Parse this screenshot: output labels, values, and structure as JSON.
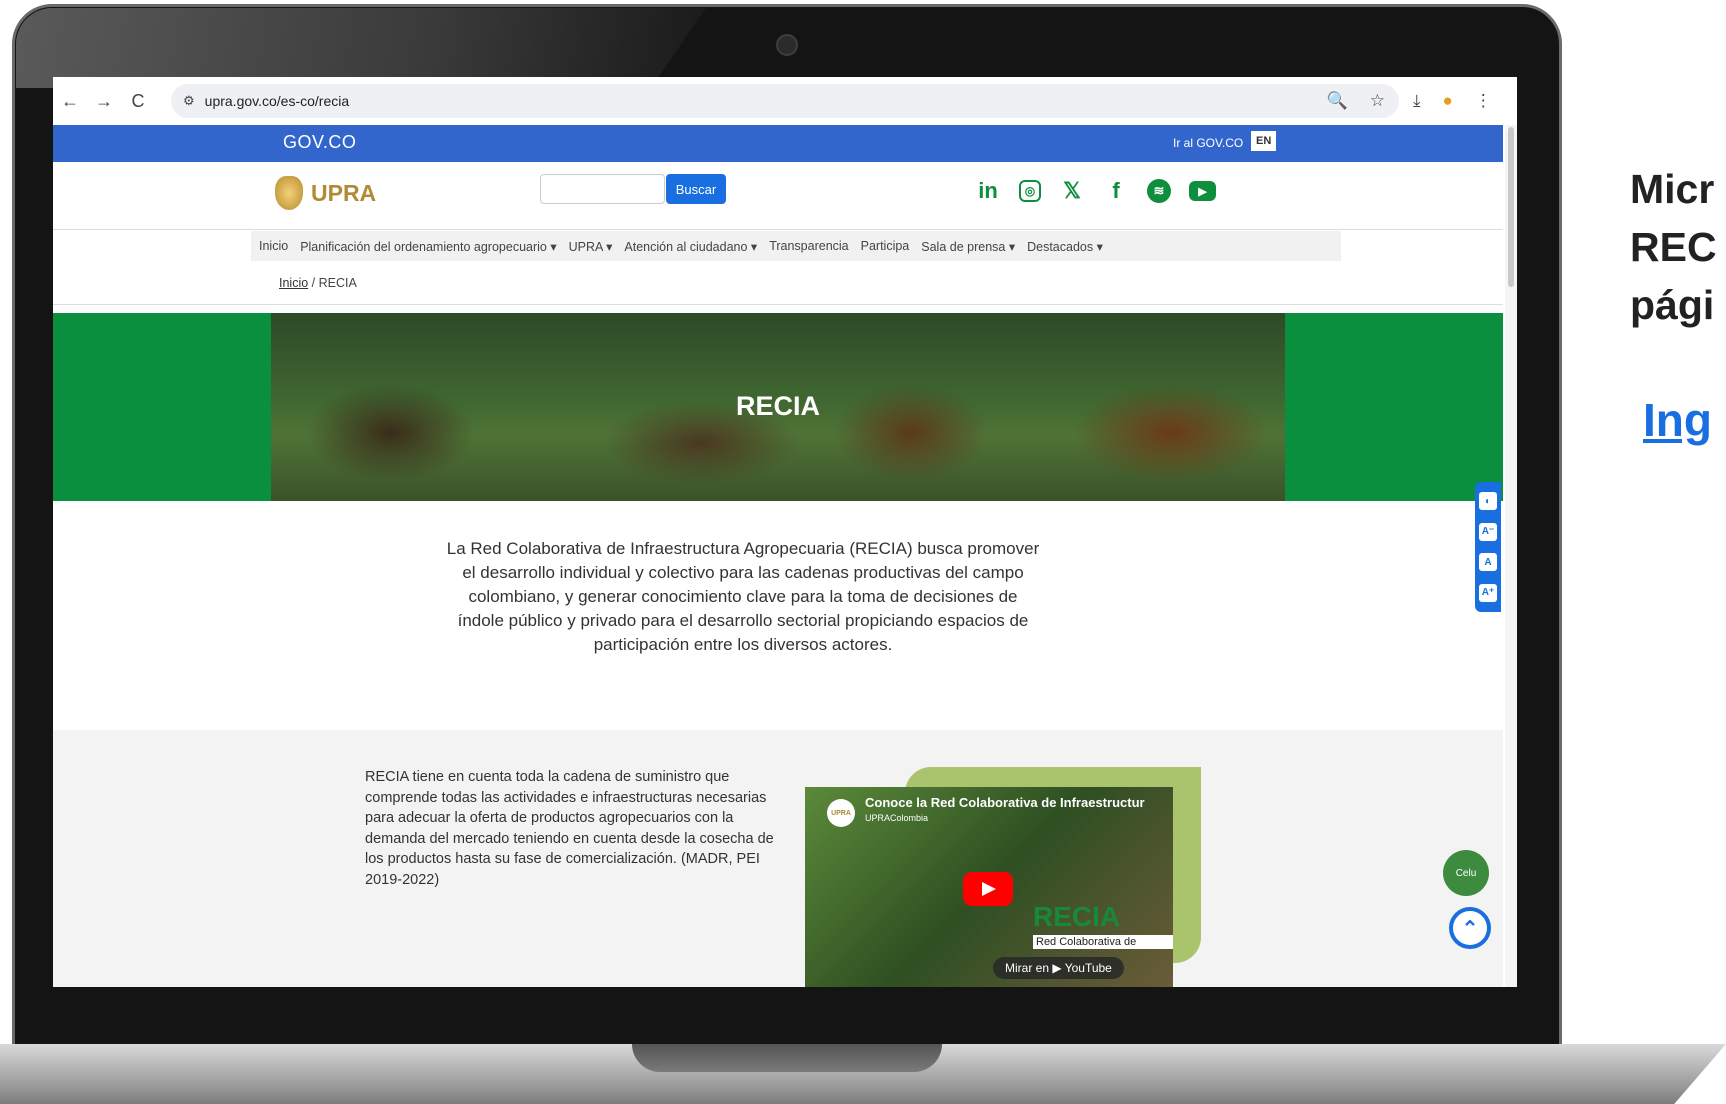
{
  "browser": {
    "url": "upra.gov.co/es-co/recia",
    "back_icon": "←",
    "forward_icon": "→",
    "reload_icon": "C",
    "tune_icon": "⚙",
    "zoom_icon": "🔍",
    "star_icon": "☆",
    "download_icon": "⤓",
    "menu_icon": "⋮"
  },
  "govbar": {
    "logo": "GOV.CO",
    "link": "Ir al GOV.CO",
    "lang": "EN"
  },
  "header": {
    "logo": "UPRA",
    "search_button": "Buscar",
    "social": [
      "in",
      "◎",
      "𝕏",
      "f",
      "≋",
      "▶"
    ]
  },
  "menu": {
    "items": [
      "Inicio",
      "Planificación del ordenamiento agropecuario ▾",
      "UPRA ▾",
      "Atención al ciudadano ▾",
      "Transparencia",
      "Participa",
      "Sala de prensa ▾",
      "Destacados ▾"
    ]
  },
  "breadcrumb": {
    "home": "Inicio",
    "sep": "/",
    "current": "RECIA"
  },
  "hero": {
    "title": "RECIA"
  },
  "intro": {
    "text": "La Red Colaborativa de Infraestructura Agropecuaria (RECIA) busca promover el desarrollo individual y colectivo para las cadenas productivas del campo colombiano, y generar conocimiento clave para la toma de decisiones de índole público y privado para el desarrollo sectorial propiciando espacios de participación entre los diversos actores."
  },
  "section": {
    "text": "RECIA tiene en cuenta toda la cadena de suministro que comprende todas las actividades e infraestructuras necesarias para adecuar la oferta de productos agropecuarios con la demanda del mercado teniendo en cuenta desde la cosecha de los productos hasta su fase de comercialización. (MADR, PEI 2019-2022)"
  },
  "video": {
    "title": "Conoce la Red Colaborativa de Infraestructur",
    "channel": "UPRAColombia",
    "avatar": "UPRA",
    "logo": "RECIA",
    "subtitle": "Red Colaborativa de",
    "watch": "Mirar en ▶ YouTube"
  },
  "a11y": {
    "items": [
      "◐",
      "A⁻",
      "A",
      "A⁺"
    ]
  },
  "floating": {
    "celu": "Celu",
    "totop": "⌃"
  },
  "caption": {
    "line1": "Micr",
    "line2": "REC",
    "line3": "pági",
    "link": "Ing"
  }
}
